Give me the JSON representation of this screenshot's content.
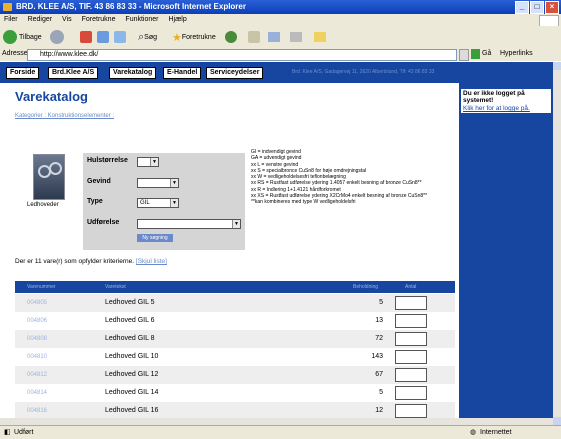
{
  "window": {
    "title": "BRD. KLEE A/S, TIF. 43 86 83 33 - Microsoft Internet Explorer"
  },
  "menu": [
    "Filer",
    "Rediger",
    "Vis",
    "Foretrukne",
    "Funktioner",
    "Hjælp"
  ],
  "toolbar": {
    "back": "Tilbage",
    "search": "Søg",
    "favorites": "Foretrukne"
  },
  "address": {
    "label": "Adresse",
    "value": "http://www.klee.dk/",
    "go": "Gå",
    "links": "Hyperlinks"
  },
  "nav": {
    "items": [
      "Forside",
      "Brd.Klee A/S",
      "Varekatalog",
      "E-Handel",
      "Serviceydelser"
    ],
    "info": "Brd. Klee A/S, Gadagervej 11, 2620 Albertslund, Tlf: 43 86 83 33"
  },
  "login": {
    "title": "Du er ikke logget på systemet!",
    "link": "Klik her for at logge på."
  },
  "catalog": {
    "title": "Varekatalog",
    "breadcrumb": "Kategorier : Konstruktionselementer :",
    "product_image_label": "Ledhoveder",
    "filters": {
      "hulstorrelse": {
        "label": "Hulstørrelse",
        "value": ""
      },
      "gevind": {
        "label": "Gevind",
        "value": ""
      },
      "type": {
        "label": "Type",
        "value": "GIL"
      },
      "udforelse": {
        "label": "Udførelse",
        "value": ""
      },
      "button": "Ny søgning"
    },
    "legend": [
      "GI = indvendigt gevind",
      "GA = udvendigt gevind",
      "xx L = venstre gevind",
      "xx S = specialbronce CuSn8 for høje omdrejningstal",
      "xx W = vedligeholdelsesfri teflonbelægning",
      "xx RS = Rustfast udførelse ydering 1.4057 enkelt besning af bronze CuSn8**",
      "xx R = Indlering 1+1.4121 hårdforkromet",
      "xx XS = Rustfast udførelse ydering X2CrMo4 enkelt besning af bronze CuSn8**",
      "**kan kombineres med type W vedligeholdelsfri"
    ],
    "result_text": "Der er 11 vare(r) som opfylder kriterierne.",
    "result_link": "[Skjul liste]",
    "table": {
      "headers": [
        "Varenummer",
        "Varetekst",
        "Beholdning",
        "Antal"
      ],
      "rows": [
        {
          "num": "004805",
          "name": "Ledhoved GIL 5",
          "qty": "5"
        },
        {
          "num": "004806",
          "name": "Ledhoved GIL 6",
          "qty": "13"
        },
        {
          "num": "004808",
          "name": "Ledhoved GIL 8",
          "qty": "72"
        },
        {
          "num": "004810",
          "name": "Ledhoved GIL 10",
          "qty": "143"
        },
        {
          "num": "004812",
          "name": "Ledhoved GIL 12",
          "qty": "67"
        },
        {
          "num": "004814",
          "name": "Ledhoved GIL 14",
          "qty": "5"
        },
        {
          "num": "004816",
          "name": "Ledhoved GIL 16",
          "qty": "12"
        }
      ]
    }
  },
  "status": {
    "left": "Udført",
    "zone": "Internettet"
  },
  "colors": {
    "brand": "#16469f",
    "row_alt": "#eeeeee",
    "link": "#6a8acc"
  }
}
